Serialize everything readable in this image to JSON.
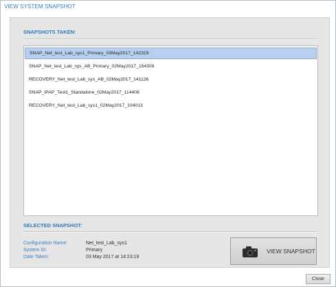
{
  "window": {
    "title": "VIEW SYSTEM SNAPSHOT"
  },
  "snapshots": {
    "heading": "SNAPSHOTS TAKEN:",
    "items": [
      {
        "label": "SNAP_Net_test_Lab_sys1_Primary_03May2017_142319",
        "selected": true
      },
      {
        "label": "SNAP_Net_test_Lab_sys_AB_Primary_02May2017_154308",
        "selected": false
      },
      {
        "label": "RECOVERY_Net_test_Lab_sys_AB_02May2017_141126",
        "selected": false
      },
      {
        "label": "SNAP_IPAP_Test1_Standalone_02May2017_114408",
        "selected": false
      },
      {
        "label": "RECOVERY_Net_test_Lab_sys1_02May2017_104013",
        "selected": false
      }
    ]
  },
  "selected": {
    "heading": "SELECTED SNAPSHOT:",
    "fields": [
      {
        "label": "Configuration Name:",
        "value": "Net_test_Lab_sys1"
      },
      {
        "label": "System ID:",
        "value": "Primary"
      },
      {
        "label": "Date Taken:",
        "value": "03 May 2017 at 14:23:19"
      }
    ]
  },
  "buttons": {
    "view_snapshot": {
      "label": "VIEW SNAPSHOT",
      "icon": "camera-icon"
    },
    "close": {
      "label": "Close"
    }
  },
  "colors": {
    "heading_blue": "#2f78b8",
    "selection": "#b8d0ee",
    "panel_bg": "#e6e6e6"
  }
}
